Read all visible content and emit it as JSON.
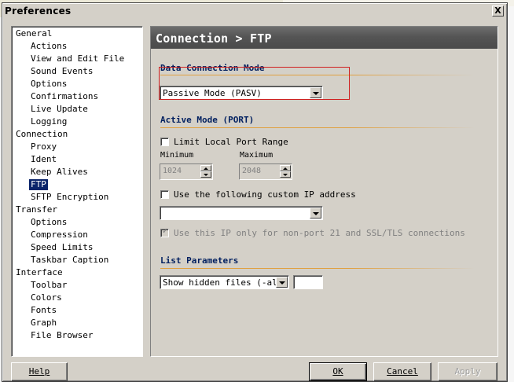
{
  "window": {
    "title": "Preferences",
    "close_label": "X"
  },
  "tree": {
    "items": [
      {
        "label": "General",
        "level": 0
      },
      {
        "label": "Actions",
        "level": 1
      },
      {
        "label": "View and Edit File",
        "level": 1
      },
      {
        "label": "Sound Events",
        "level": 1
      },
      {
        "label": "Options",
        "level": 1
      },
      {
        "label": "Confirmations",
        "level": 1
      },
      {
        "label": "Live Update",
        "level": 1
      },
      {
        "label": "Logging",
        "level": 1
      },
      {
        "label": "Connection",
        "level": 0
      },
      {
        "label": "Proxy",
        "level": 1
      },
      {
        "label": "Ident",
        "level": 1
      },
      {
        "label": "Keep Alives",
        "level": 1
      },
      {
        "label": "FTP",
        "level": 1,
        "selected": true
      },
      {
        "label": "SFTP Encryption",
        "level": 1
      },
      {
        "label": "Transfer",
        "level": 0
      },
      {
        "label": "Options",
        "level": 1
      },
      {
        "label": "Compression",
        "level": 1
      },
      {
        "label": "Speed Limits",
        "level": 1
      },
      {
        "label": "Taskbar Caption",
        "level": 1
      },
      {
        "label": "Interface",
        "level": 0
      },
      {
        "label": "Toolbar",
        "level": 1
      },
      {
        "label": "Colors",
        "level": 1
      },
      {
        "label": "Fonts",
        "level": 1
      },
      {
        "label": "Graph",
        "level": 1
      },
      {
        "label": "File Browser",
        "level": 1
      }
    ]
  },
  "panel": {
    "title": "Connection > FTP",
    "data_connection": {
      "heading": "Data Connection Mode",
      "mode_value": "Passive Mode (PASV)"
    },
    "active_mode": {
      "heading": "Active Mode (PORT)",
      "limit_range_label": "Limit Local Port Range",
      "limit_range_checked": false,
      "minimum_label": "Minimum",
      "maximum_label": "Maximum",
      "minimum_value": "1024",
      "maximum_value": "2048",
      "custom_ip_label": "Use the following custom IP address",
      "custom_ip_checked": false,
      "custom_ip_value": "",
      "ip_only_label": "Use this IP only for non-port 21 and SSL/TLS connections"
    },
    "list_params": {
      "heading": "List Parameters",
      "option_value": "Show hidden files (-al)",
      "extra_value": ""
    }
  },
  "buttons": {
    "help": "Help",
    "ok": "OK",
    "cancel": "Cancel",
    "apply": "Apply"
  },
  "colors": {
    "selection": "#0a246a",
    "heading": "#001f5f",
    "accent": "#e0a040",
    "highlight_box": "#d02020"
  }
}
